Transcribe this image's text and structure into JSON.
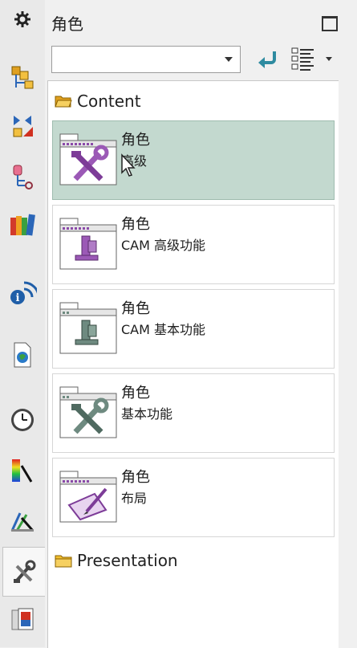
{
  "panel": {
    "title": "角色",
    "combo_value": "",
    "back_icon": "back-arrow-icon",
    "view_icon": "list-view-icon"
  },
  "left_toolbar": [
    {
      "icon": "gear-icon"
    },
    {
      "icon": "assembly-navigator-icon"
    },
    {
      "icon": "constraint-navigator-icon"
    },
    {
      "icon": "part-navigator-icon"
    },
    {
      "icon": "reuse-library-icon"
    },
    {
      "icon": "hd3d-tools-icon"
    },
    {
      "icon": "web-browser-icon"
    },
    {
      "icon": "history-icon"
    },
    {
      "icon": "visualization-icon"
    },
    {
      "icon": "process-studio-icon"
    },
    {
      "icon": "roles-icon",
      "active": true
    },
    {
      "icon": "system-scenes-icon"
    }
  ],
  "tree": {
    "content_folder": "Content",
    "presentation_folder": "Presentation",
    "roles": [
      {
        "title": "角色",
        "subtitle": "高级",
        "icon": "advanced-tools-icon",
        "selected": true
      },
      {
        "title": "角色",
        "subtitle": "CAM 高级功能",
        "icon": "cam-advanced-mill-icon",
        "selected": false
      },
      {
        "title": "角色",
        "subtitle": "CAM 基本功能",
        "icon": "cam-essentials-mill-icon",
        "selected": false
      },
      {
        "title": "角色",
        "subtitle": "基本功能",
        "icon": "essentials-tools-icon",
        "selected": false
      },
      {
        "title": "角色",
        "subtitle": "布局",
        "icon": "layout-pencil-icon",
        "selected": false
      }
    ]
  },
  "colors": {
    "selected_bg": "#c3d9cf",
    "purple_icon": "#9b59b6",
    "gray_icon": "#6e8a80"
  }
}
